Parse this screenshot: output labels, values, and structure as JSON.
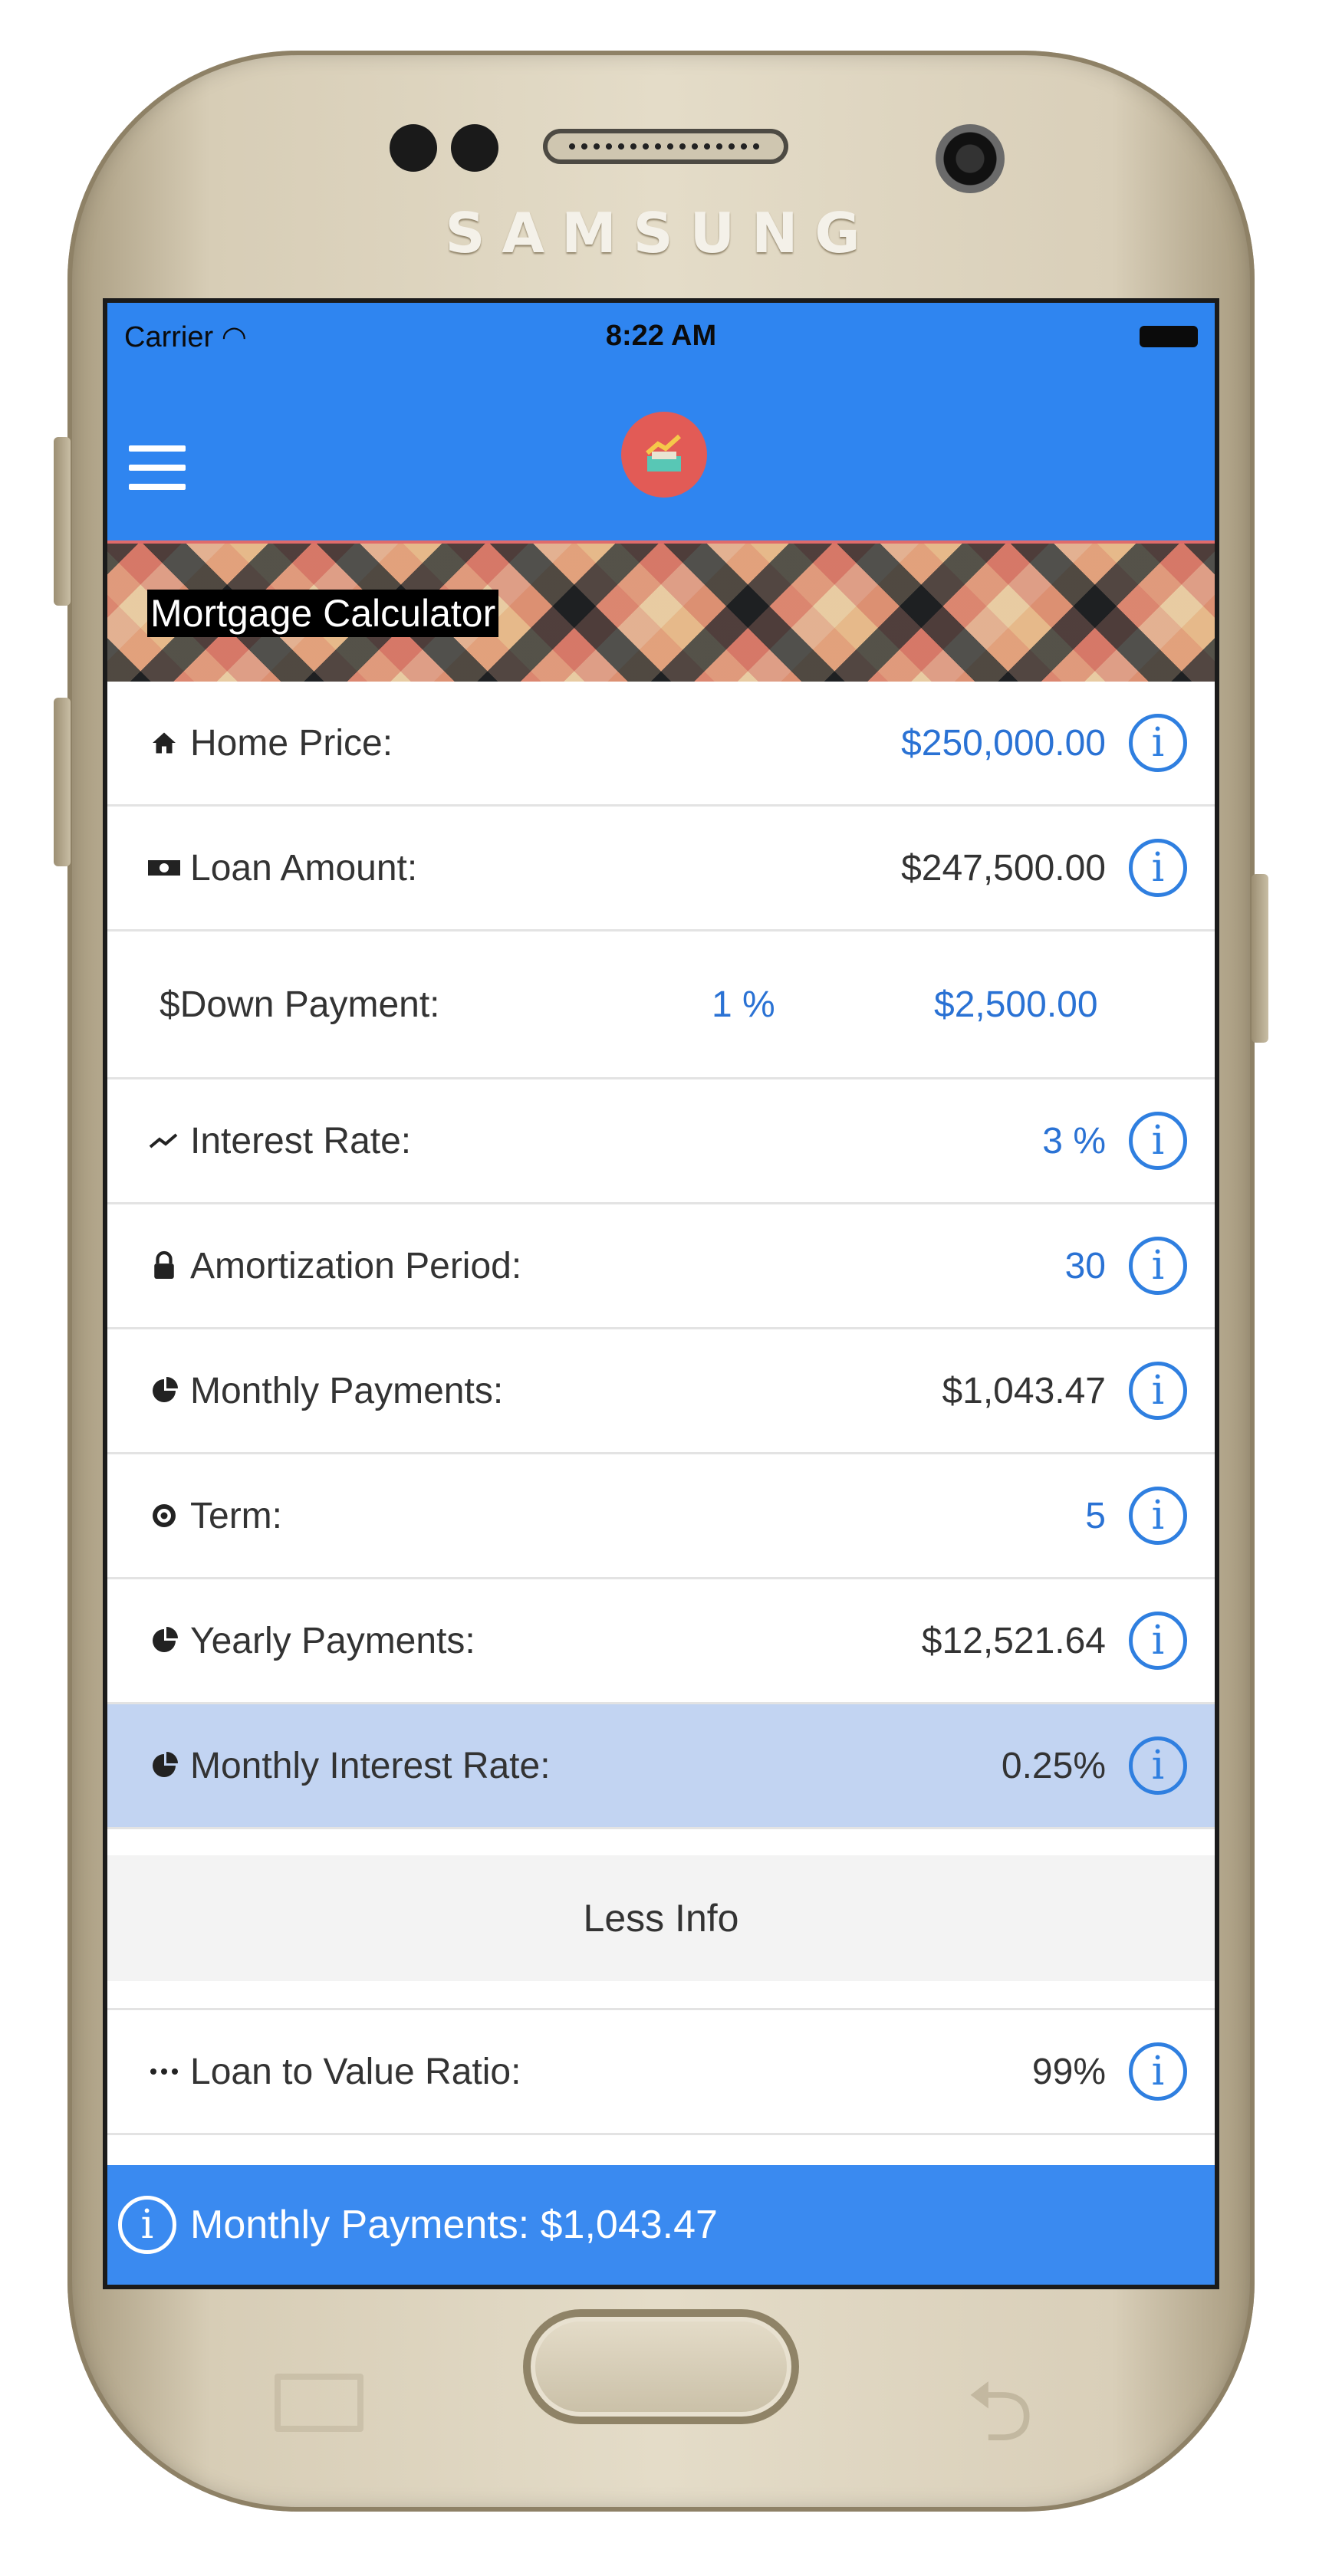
{
  "device": {
    "brand": "SAMSUNG"
  },
  "status_bar": {
    "carrier": "Carrier",
    "time": "8:22 AM"
  },
  "banner": {
    "title": "Mortgage Calculator"
  },
  "rows": {
    "home_price": {
      "label": "Home Price:",
      "value": "$250,000.00",
      "icon": "home-icon"
    },
    "loan_amount": {
      "label": "Loan Amount:",
      "value": "$247,500.00",
      "icon": "money-icon"
    },
    "down_payment": {
      "label": "$Down Payment:",
      "percent": "1 %",
      "amount": "$2,500.00"
    },
    "interest_rate": {
      "label": "Interest Rate:",
      "value": "3 %",
      "icon": "trend-icon"
    },
    "amortization": {
      "label": "Amortization Period:",
      "value": "30",
      "icon": "lock-icon"
    },
    "monthly_payments": {
      "label": "Monthly Payments:",
      "value": "$1,043.47",
      "icon": "pie-chart-icon"
    },
    "term": {
      "label": "Term:",
      "value": "5",
      "icon": "target-icon"
    },
    "yearly_payments": {
      "label": "Yearly Payments:",
      "value": "$12,521.64",
      "icon": "pie-chart-icon"
    },
    "monthly_interest": {
      "label": "Monthly Interest Rate:",
      "value": "0.25%",
      "icon": "pie-chart-icon"
    },
    "loan_to_value": {
      "label": "Loan to Value Ratio:",
      "value": "99%",
      "icon": "ellipsis-icon"
    }
  },
  "less_info_label": "Less Info",
  "footer": {
    "text": "Monthly Payments: $1,043.47"
  },
  "colors": {
    "header_blue": "#2f85f0",
    "value_blue": "#2a72d4",
    "highlight": "#c2d4f2"
  }
}
